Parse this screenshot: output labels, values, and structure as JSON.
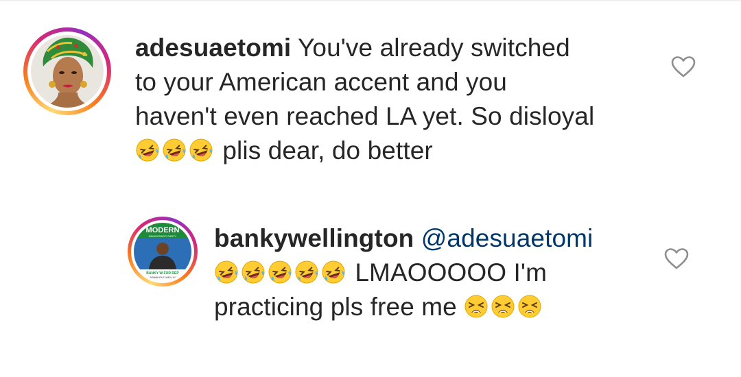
{
  "comments": [
    {
      "username": "adesuaetomi",
      "text_line1": " You've already switched",
      "text_line2": "to your American accent and you",
      "text_line3": "haven't even reached LA yet. So disloyal",
      "text_line4": " plis dear, do better",
      "emoji_line4": [
        "rolling-on-floor-laughing",
        "rolling-on-floor-laughing",
        "rolling-on-floor-laughing"
      ],
      "liked": false
    },
    {
      "username": "bankywellington",
      "mention": "@adesuaetomi",
      "text_line2": " LMAOOOOO I'm",
      "text_line3": "practicing pls free me ",
      "emoji_line2": [
        "rolling-on-floor-laughing",
        "rolling-on-floor-laughing",
        "rolling-on-floor-laughing",
        "rolling-on-floor-laughing",
        "rolling-on-floor-laughing"
      ],
      "emoji_line3": [
        "tired-face",
        "tired-face",
        "tired-face"
      ],
      "avatar_text": {
        "headline": "MODERN",
        "sub": "DEMOCRATIC PARTY",
        "footer1": "BANKY W FOR REP",
        "footer2": "OLUWABANKOLE WELLINGTON"
      },
      "liked": false
    }
  ],
  "colors": {
    "text": "#262626",
    "mention": "#00376b",
    "heart_outline": "#8e8e8e",
    "story_ring": [
      "#feda75",
      "#fa7e1e",
      "#d62976",
      "#962fbf"
    ]
  }
}
